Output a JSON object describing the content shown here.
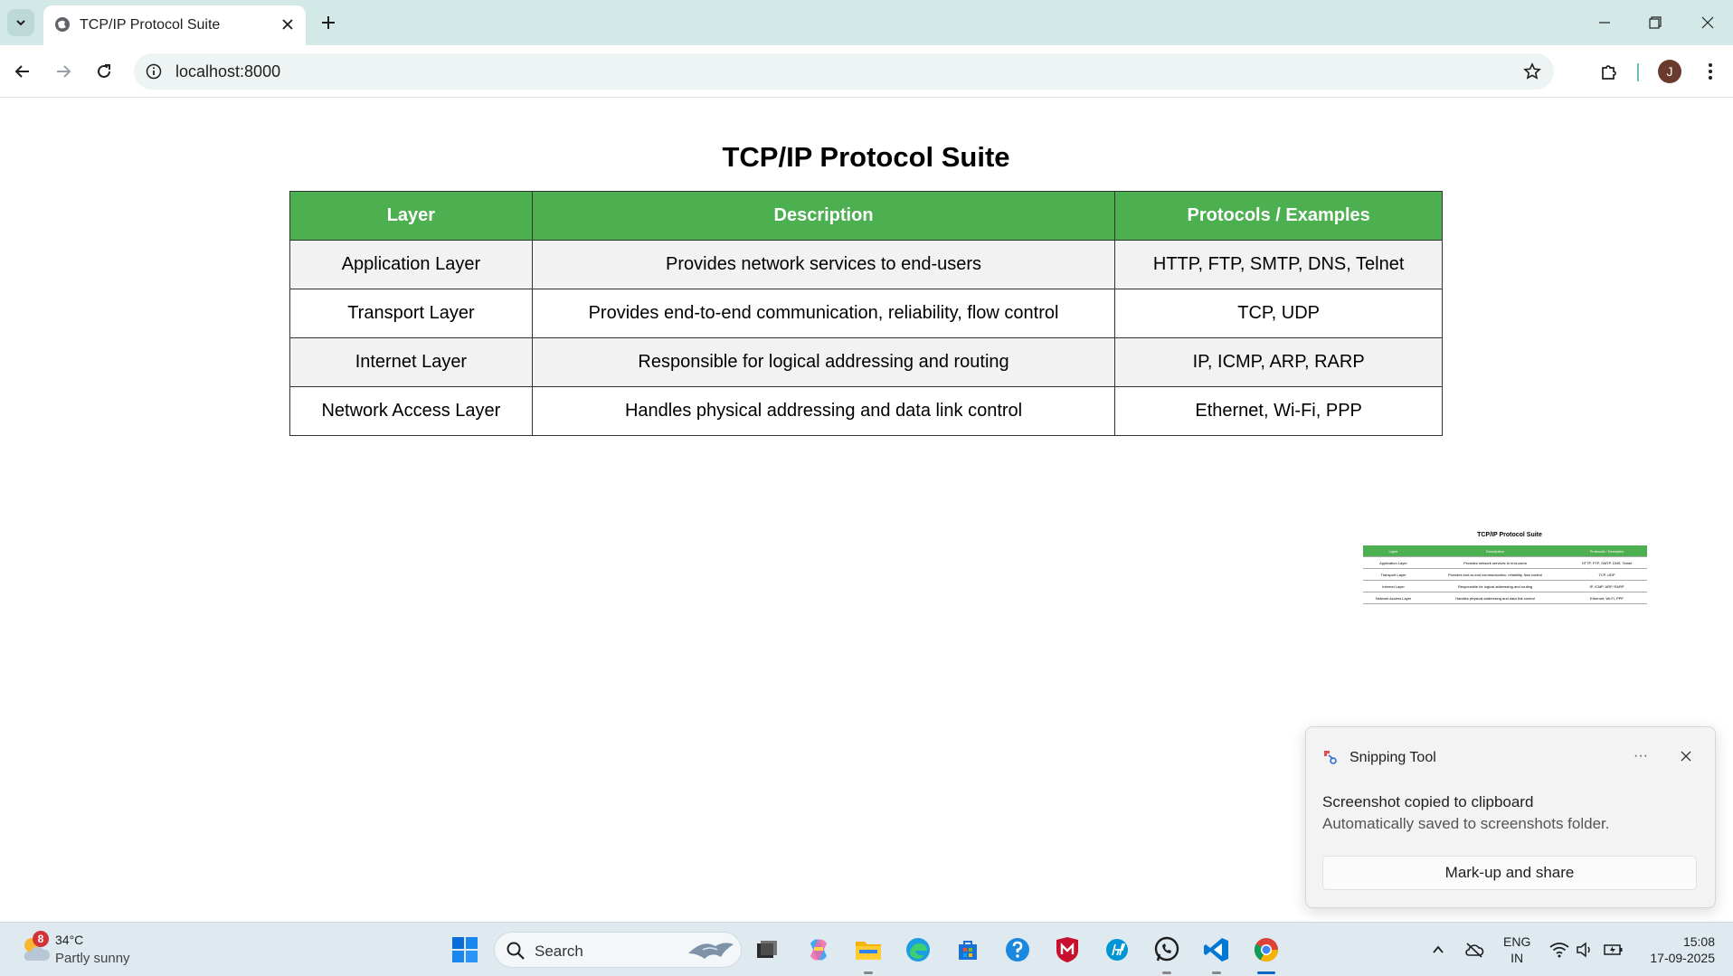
{
  "browser": {
    "tab_title": "TCP/IP Protocol Suite",
    "url": "localhost:8000",
    "profile_initial": "J"
  },
  "page": {
    "title": "TCP/IP Protocol Suite",
    "headers": [
      "Layer",
      "Description",
      "Protocols / Examples"
    ],
    "rows": [
      {
        "layer": "Application Layer",
        "description": "Provides network services to end-users",
        "protocols": "HTTP, FTP, SMTP, DNS, Telnet"
      },
      {
        "layer": "Transport Layer",
        "description": "Provides end-to-end communication, reliability, flow control",
        "protocols": "TCP, UDP"
      },
      {
        "layer": "Internet Layer",
        "description": "Responsible for logical addressing and routing",
        "protocols": "IP, ICMP, ARP, RARP"
      },
      {
        "layer": "Network Access Layer",
        "description": "Handles physical addressing and data link control",
        "protocols": "Ethernet, Wi-Fi, PPP"
      }
    ],
    "header_color": "#4caf50"
  },
  "toast": {
    "app_name": "Snipping Tool",
    "more_label": "···",
    "heading": "Screenshot copied to clipboard",
    "body": "Automatically saved to screenshots folder.",
    "button_label": "Mark-up and share"
  },
  "taskbar": {
    "weather_badge": "8",
    "weather_temp": "34°C",
    "weather_desc": "Partly sunny",
    "search_label": "Search",
    "lang_line1": "ENG",
    "lang_line2": "IN",
    "time": "15:08",
    "date": "17-09-2025"
  }
}
